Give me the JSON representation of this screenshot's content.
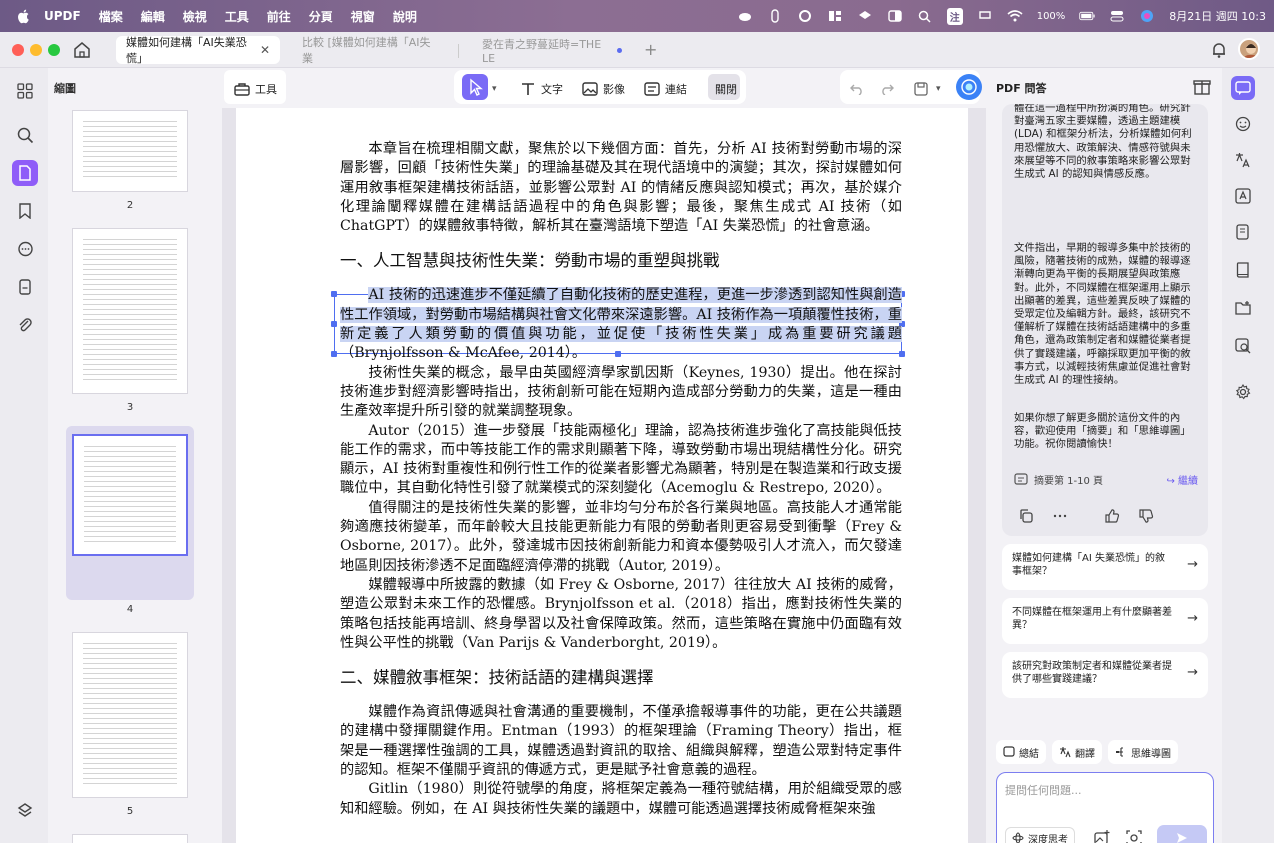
{
  "menubar": {
    "app": "UPDF",
    "items": [
      "檔案",
      "編輯",
      "檢視",
      "工具",
      "前往",
      "分頁",
      "視窗",
      "說明"
    ],
    "battery": "100%",
    "ime": "注",
    "datetime": "8月21日 週四 10:3"
  },
  "tabs": [
    {
      "label": "媒體如何建構「AI失業恐慌」",
      "active": true
    },
    {
      "label": "比較 [媒體如何建構「AI失業",
      "active": false
    },
    {
      "label": "愛在青之野蔓延時=THE LE",
      "active": false
    }
  ],
  "thumbnails": {
    "title": "縮圖",
    "pages": [
      "2",
      "3",
      "4",
      "5"
    ]
  },
  "toolbar": {
    "tools_label": "工具",
    "text_label": "文字",
    "image_label": "影像",
    "link_label": "連結",
    "close_label": "關閉"
  },
  "document": {
    "p1": "本章旨在梳理相關文獻，聚焦於以下幾個方面：首先，分析 AI 技術對勞動市場的深層影響，回顧「技術性失業」的理論基礎及其在現代語境中的演變；其次，探討媒體如何運用敘事框架建構技術話語，並影響公眾對 AI 的情緒反應與認知模式；再次，基於媒介化理論闡釋媒體在建構話語過程中的角色與影響；最後，聚焦生成式 AI 技術（如 ChatGPT）的媒體敘事特徵，解析其在臺灣語境下塑造「AI 失業恐慌」的社會意涵。",
    "h1": "一、人工智慧與技術性失業：勞動市場的重塑與挑戰",
    "p2_hl": "AI 技術的迅速進步不僅延續了自動化技術的歷史進程，更進一步滲透到認知性與創造性工作領域，對勞動市場結構與社會文化帶來深遠影響。AI 技術作為一項顛覆性技術，重新定義了人類勞動的價值與功能，並促使「技術性失業」成為重要研究議題",
    "p2_rest": "（Brynjolfsson & McAfee, 2014）。",
    "p3": "技術性失業的概念，最早由英國經濟學家凱因斯（Keynes, 1930）提出。他在探討技術進步對經濟影響時指出，技術創新可能在短期內造成部分勞動力的失業，這是一種由生產效率提升所引發的就業調整現象。",
    "p4": "Autor（2015）進一步發展「技能兩極化」理論，認為技術進步強化了高技能與低技能工作的需求，而中等技能工作的需求則顯著下降，導致勞動市場出現結構性分化。研究顯示，AI 技術對重複性和例行性工作的從業者影響尤為顯著，特別是在製造業和行政支援職位中，其自動化特性引發了就業模式的深刻變化（Acemoglu & Restrepo, 2020）。",
    "p5": "值得關注的是技術性失業的影響，並非均勻分布於各行業與地區。高技能人才通常能夠適應技術變革，而年齡較大且技能更新能力有限的勞動者則更容易受到衝擊（Frey & Osborne, 2017）。此外，發達城市因技術創新能力和資本優勢吸引人才流入，而欠發達地區則因技術滲透不足面臨經濟停滯的挑戰（Autor, 2019）。",
    "p6": "媒體報導中所披露的數據（如 Frey & Osborne, 2017）往往放大 AI 技術的威脅，塑造公眾對未來工作的恐懼感。Brynjolfsson et al.（2018）指出，應對技術性失業的策略包括技能再培訓、終身學習以及社會保障政策。然而，這些策略在實施中仍面臨有效性與公平性的挑戰（Van Parijs & Vanderborght, 2019）。",
    "h2": "二、媒體敘事框架：技術話語的建構與選擇",
    "p7": "媒體作為資訊傳遞與社會溝通的重要機制，不僅承擔報導事件的功能，更在公共議題的建構中發揮關鍵作用。Entman（1993）的框架理論（Framing Theory）指出，框架是一種選擇性強調的工具，媒體透過對資訊的取捨、組織與解釋，塑造公眾對特定事件的認知。框架不僅關乎資訊的傳遞方式，更是賦予社會意義的過程。",
    "p8": "Gitlin（1980）則從符號學的角度，將框架定義為一種符號結構，用於組織受眾的感知和經驗。例如，在 AI 與技術性失業的議題中，媒體可能透過選擇技術威脅框架來強"
  },
  "ai_panel": {
    "title": "PDF 問答",
    "answer_p1": "體在這一過程中所扮演的角色。研究針對臺灣五家主要媒體，透過主題建模 (LDA) 和框架分析法，分析媒體如何利用恐懼放大、政策解決、情感符號與未來展望等不同的敘事策略來影響公眾對生成式 AI 的認知與情感反應。",
    "answer_p2": "文件指出，早期的報導多集中於技術的風險，隨著技術的成熟，媒體的報導逐漸轉向更為平衡的長期展望與政策應對。此外，不同媒體在框架運用上顯示出顯著的差異，這些差異反映了媒體的受眾定位及編輯方針。最終，該研究不僅解析了媒體在技術話語建構中的多重角色，還為政策制定者和媒體從業者提供了實踐建議，呼籲採取更加平衡的敘事方式，以減輕技術焦慮並促進社會對生成式 AI 的理性接納。",
    "answer_p3": "如果你想了解更多關於這份文件的內容，歡迎使用「摘要」和「思維導圖」功能。祝你閱讀愉快！",
    "summary_label": "摘要第 1-10 頁",
    "continue_label": "繼續",
    "suggestions": [
      "媒體如何建構「AI 失業恐慌」的敘事框架？",
      "不同媒體在框架運用上有什麼顯著差異？",
      "該研究對政策制定者和媒體從業者提供了哪些實踐建議？"
    ],
    "chips": [
      "總結",
      "翻譯",
      "思維導圖"
    ],
    "input_placeholder": "提問任何問題...",
    "deep_think_label": "深度思考"
  }
}
